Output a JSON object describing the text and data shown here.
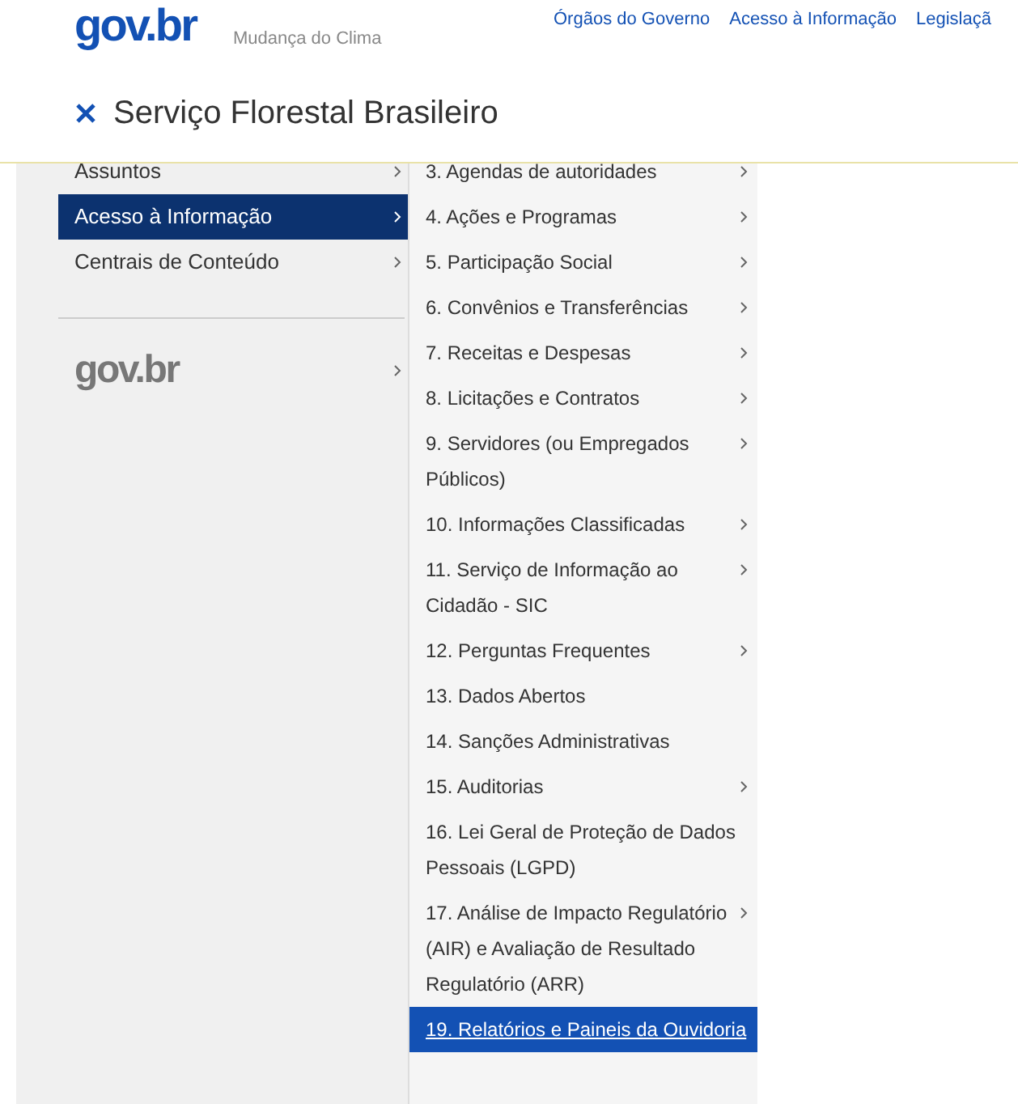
{
  "header": {
    "logo": "gov.br",
    "subtitle": "Mudança do Clima",
    "nav_links": [
      "Órgãos do Governo",
      "Acesso à Informação",
      "Legislaçã"
    ]
  },
  "page_title": "Serviço Florestal Brasileiro",
  "menu": {
    "items": [
      {
        "label": "Assuntos",
        "selected": false,
        "has_submenu": true
      },
      {
        "label": "Acesso à Informação",
        "selected": true,
        "has_submenu": true
      },
      {
        "label": "Centrais de Conteúdo",
        "selected": false,
        "has_submenu": true
      }
    ],
    "footer_logo": {
      "label": "gov.br",
      "has_submenu": true
    }
  },
  "submenu": {
    "items": [
      {
        "label": "3. Agendas de autoridades",
        "selected": false,
        "has_submenu": true
      },
      {
        "label": "4. Ações e Programas",
        "selected": false,
        "has_submenu": true
      },
      {
        "label": "5. Participação Social",
        "selected": false,
        "has_submenu": true
      },
      {
        "label": "6. Convênios e Transferências",
        "selected": false,
        "has_submenu": true
      },
      {
        "label": "7. Receitas e Despesas",
        "selected": false,
        "has_submenu": true
      },
      {
        "label": "8. Licitações e Contratos",
        "selected": false,
        "has_submenu": true
      },
      {
        "label": "9. Servidores (ou Empregados Públicos)",
        "selected": false,
        "has_submenu": true
      },
      {
        "label": "10. Informações Classificadas",
        "selected": false,
        "has_submenu": true
      },
      {
        "label": "11. Serviço de Informação ao Cidadão - SIC",
        "selected": false,
        "has_submenu": true
      },
      {
        "label": "12. Perguntas Frequentes",
        "selected": false,
        "has_submenu": true
      },
      {
        "label": "13. Dados Abertos",
        "selected": false,
        "has_submenu": false
      },
      {
        "label": "14. Sanções Administrativas",
        "selected": false,
        "has_submenu": false
      },
      {
        "label": "15. Auditorias",
        "selected": false,
        "has_submenu": true
      },
      {
        "label": "16. Lei Geral de Proteção de Dados Pessoais (LGPD)",
        "selected": false,
        "has_submenu": false
      },
      {
        "label": "17. Análise de Impacto Regulatório (AIR) e Avaliação de Resultado Regulatório (ARR)",
        "selected": false,
        "has_submenu": true
      },
      {
        "label": "19. Relatórios e Paineis da Ouvidoria",
        "selected": true,
        "has_submenu": false
      }
    ]
  }
}
